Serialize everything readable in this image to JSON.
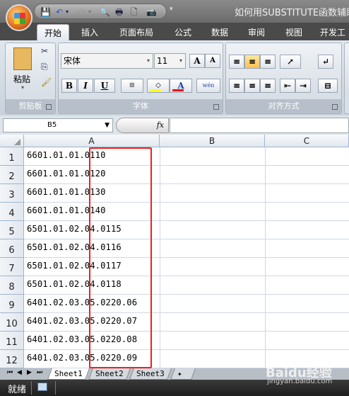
{
  "window": {
    "title": "如何用SUBSTITUTE函数辅助"
  },
  "qat": {
    "icons": [
      "save-icon",
      "undo-icon",
      "redo-icon",
      "print-preview-icon",
      "print-icon",
      "new-icon",
      "camera-icon"
    ]
  },
  "tabs": [
    {
      "label": "开始",
      "active": true
    },
    {
      "label": "插入"
    },
    {
      "label": "页面布局"
    },
    {
      "label": "公式"
    },
    {
      "label": "数据"
    },
    {
      "label": "审阅"
    },
    {
      "label": "视图"
    },
    {
      "label": "开发工"
    }
  ],
  "ribbon": {
    "clipboard": {
      "label": "剪贴板",
      "paste": "粘贴"
    },
    "font": {
      "label": "字体",
      "font_name": "宋体",
      "font_size": "11",
      "bold": "B",
      "italic": "I",
      "underline": "U",
      "grow": "A",
      "shrink": "A",
      "color_a": "A",
      "phonetic": "wén",
      "fill_color": "#ffff00",
      "font_color": "#ff0000"
    },
    "alignment": {
      "label": "对齐方式"
    }
  },
  "formula_bar": {
    "name_box": "B5",
    "fx": "fx",
    "formula": ""
  },
  "columns": [
    "A",
    "B",
    "C"
  ],
  "rows": [
    {
      "n": "1",
      "a": "6601.01.01.0110"
    },
    {
      "n": "2",
      "a": "6601.01.01.0120"
    },
    {
      "n": "3",
      "a": "6601.01.01.0130"
    },
    {
      "n": "4",
      "a": "6601.01.01.0140"
    },
    {
      "n": "5",
      "a": "6501.01.02.04.0115"
    },
    {
      "n": "6",
      "a": "6501.01.02.04.0116"
    },
    {
      "n": "7",
      "a": "6501.01.02.04.0117"
    },
    {
      "n": "8",
      "a": "6501.01.02.04.0118"
    },
    {
      "n": "9",
      "a": "6401.02.03.05.0220.06"
    },
    {
      "n": "10",
      "a": "6401.02.03.05.0220.07"
    },
    {
      "n": "11",
      "a": "6401.02.03.05.0220.08"
    },
    {
      "n": "12",
      "a": "6401.02.03.05.0220.09"
    }
  ],
  "sheets": [
    "Sheet1",
    "Sheet2",
    "Sheet3"
  ],
  "status": {
    "text": "就绪"
  },
  "watermark": {
    "brand": "Baidu经验",
    "url": "jingyan.baidu.com"
  },
  "highlight_color": "#f02020"
}
